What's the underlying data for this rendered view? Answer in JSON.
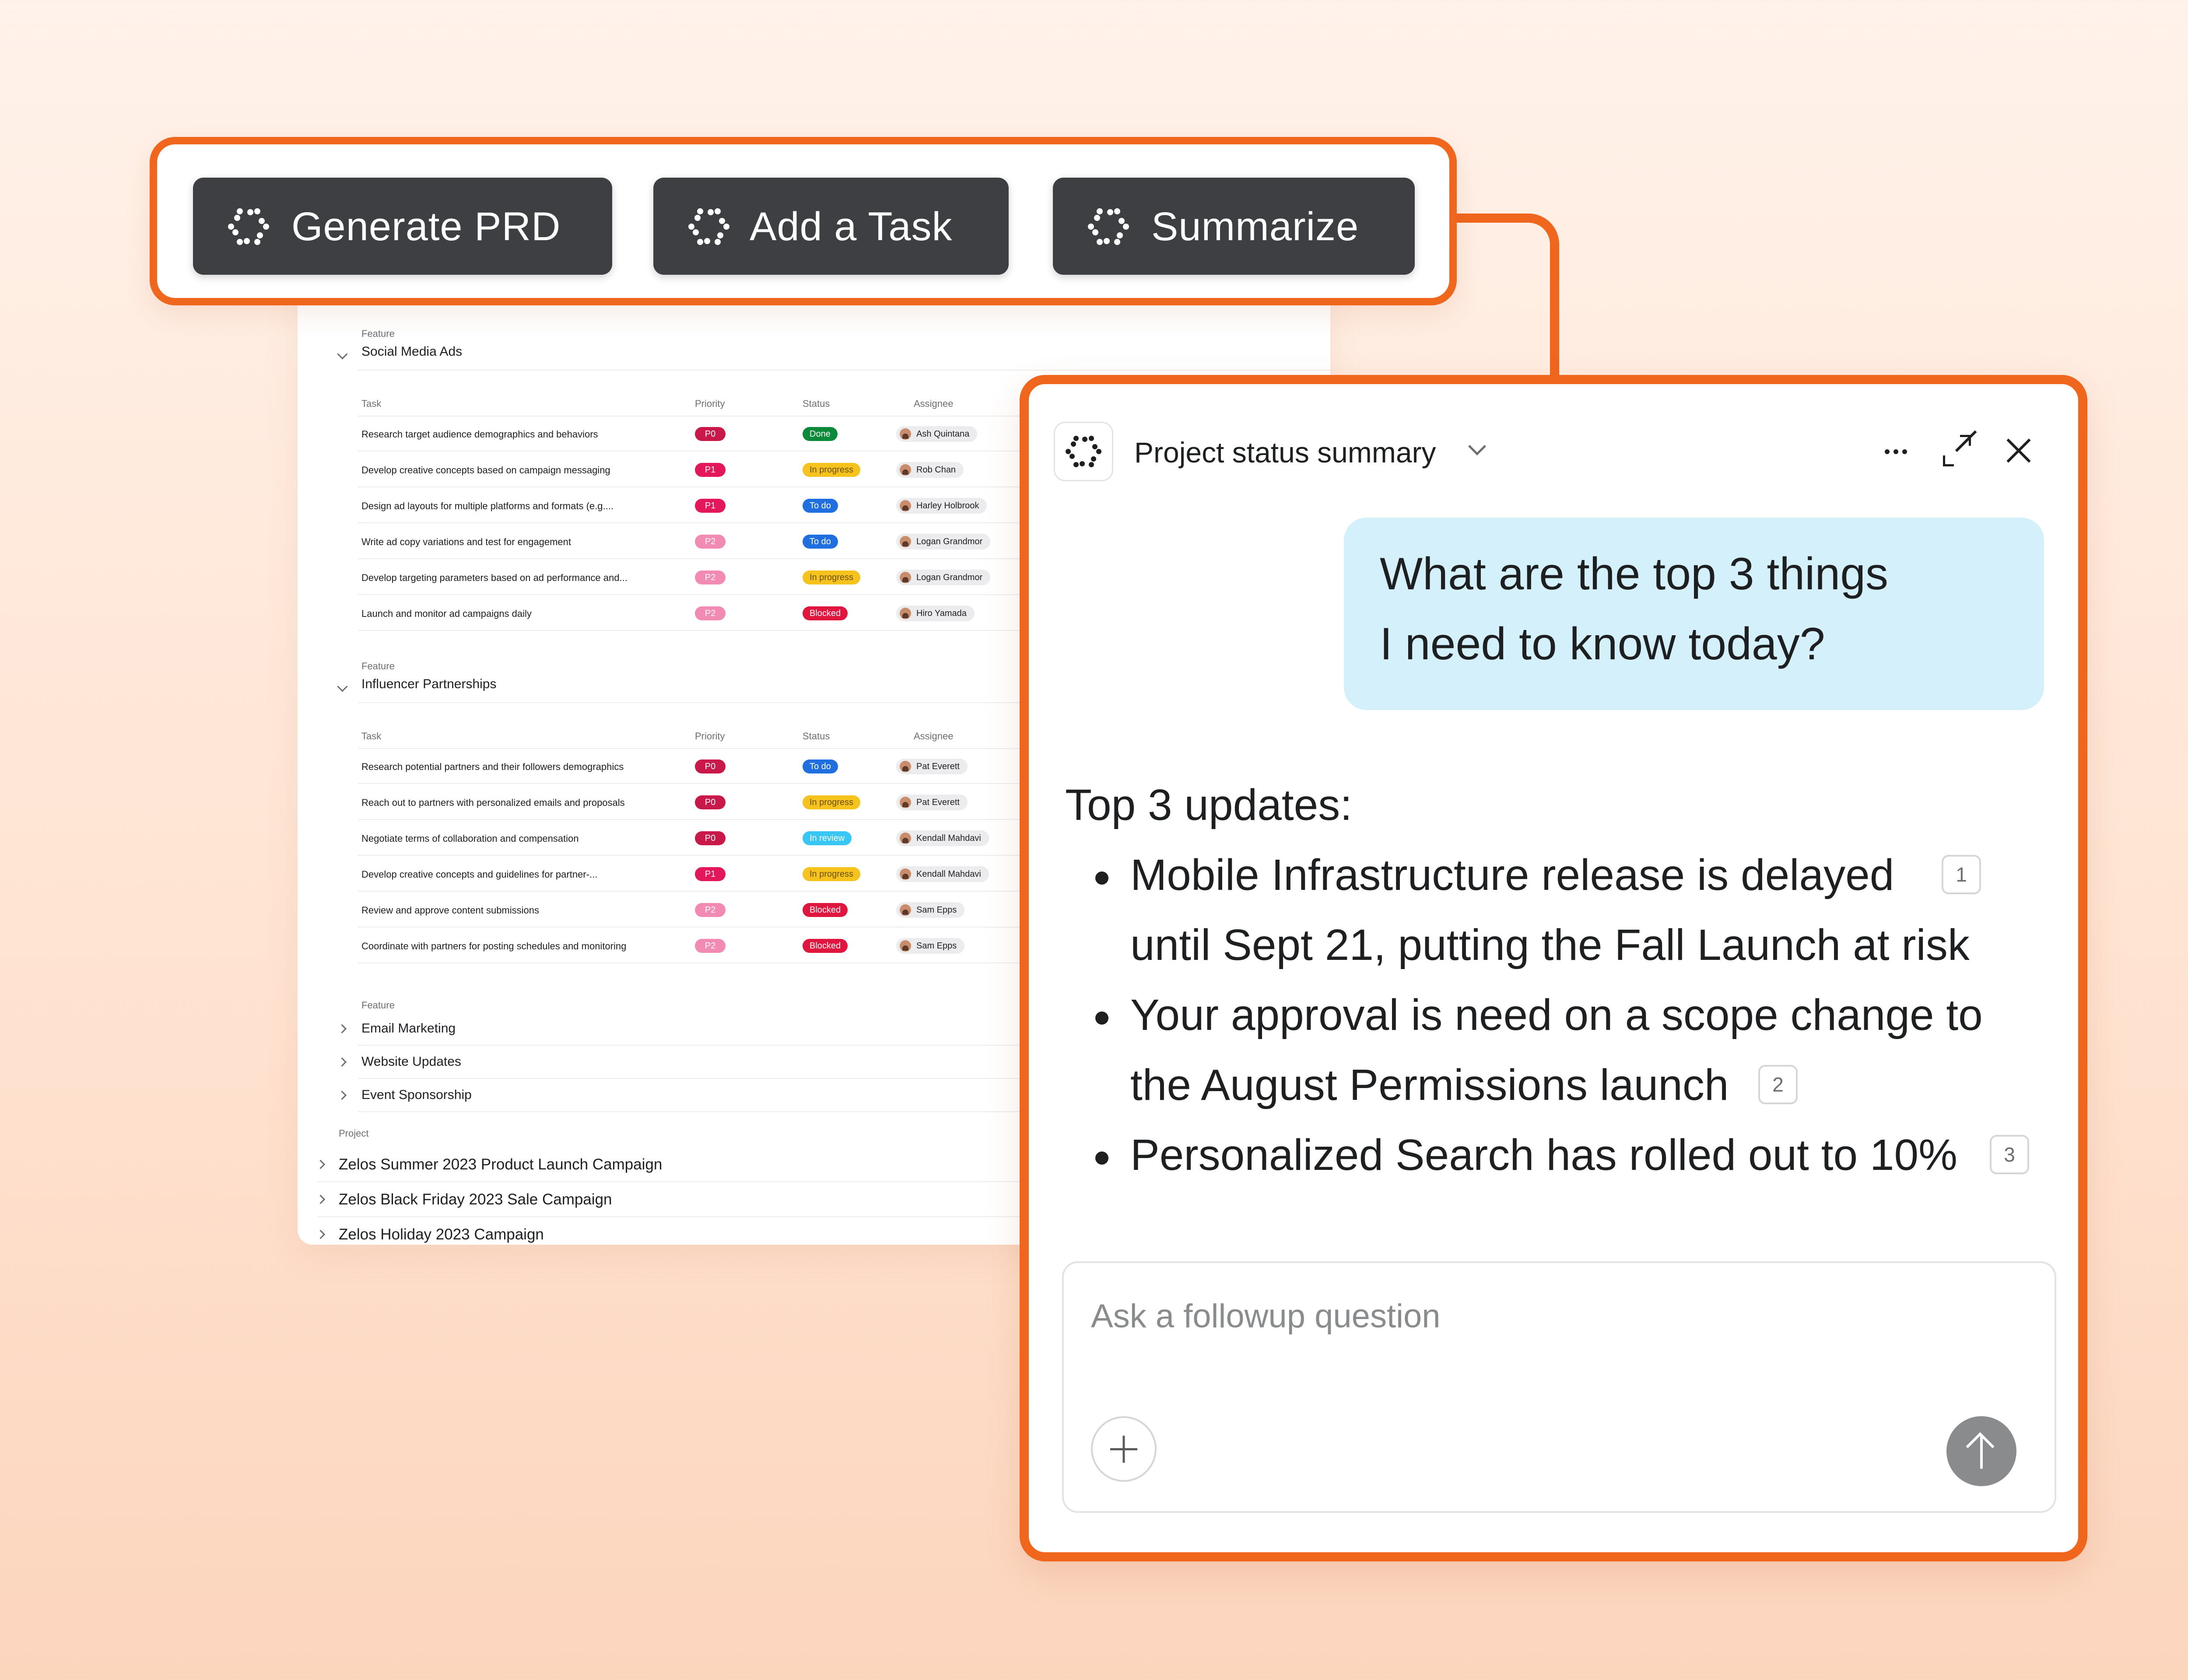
{
  "colors": {
    "accent": "#f0661c",
    "toolbar_button": "#3e3f42",
    "user_bubble": "#d3f0fb"
  },
  "toolbar": {
    "buttons": [
      {
        "label": "Generate PRD",
        "icon": "sparkle-icon"
      },
      {
        "label": "Add a Task",
        "icon": "sparkle-icon"
      },
      {
        "label": "Summarize",
        "icon": "sparkle-icon"
      }
    ]
  },
  "table": {
    "feature_kicker": "Feature",
    "columns": {
      "task": "Task",
      "priority": "Priority",
      "status": "Status",
      "assignee": "Assignee"
    },
    "features": [
      {
        "title": "Social Media Ads",
        "rows": [
          {
            "task": "Research target audience demographics and behaviors",
            "priority": "P0",
            "status": "Done",
            "assignee": "Ash Quintana"
          },
          {
            "task": "Develop creative concepts based on campaign messaging",
            "priority": "P1",
            "status": "In progress",
            "assignee": "Rob Chan"
          },
          {
            "task": "Design ad layouts for multiple platforms and formats (e.g....",
            "priority": "P1",
            "status": "To do",
            "assignee": "Harley Holbrook"
          },
          {
            "task": "Write ad copy variations and test for engagement",
            "priority": "P2",
            "status": "To do",
            "assignee": "Logan Grandmor"
          },
          {
            "task": "Develop targeting parameters based on ad performance and...",
            "priority": "P2",
            "status": "In progress",
            "assignee": "Logan Grandmor"
          },
          {
            "task": "Launch and monitor ad campaigns daily",
            "priority": "P2",
            "status": "Blocked",
            "assignee": "Hiro Yamada"
          }
        ]
      },
      {
        "title": "Influencer Partnerships",
        "rows": [
          {
            "task": "Research potential partners and their followers demographics",
            "priority": "P0",
            "status": "To do",
            "assignee": "Pat Everett"
          },
          {
            "task": "Reach out to partners with personalized emails and proposals",
            "priority": "P0",
            "status": "In progress",
            "assignee": "Pat Everett"
          },
          {
            "task": "Negotiate terms of collaboration and compensation",
            "priority": "P0",
            "status": "In review",
            "assignee": "Kendall Mahdavi"
          },
          {
            "task": "Develop creative concepts and guidelines for partner-...",
            "priority": "P1",
            "status": "In progress",
            "assignee": "Kendall Mahdavi"
          },
          {
            "task": "Review and approve content submissions",
            "priority": "P2",
            "status": "Blocked",
            "assignee": "Sam Epps"
          },
          {
            "task": "Coordinate with partners for posting schedules and monitoring",
            "priority": "P2",
            "status": "Blocked",
            "assignee": "Sam Epps"
          }
        ]
      }
    ],
    "collapsed_features": [
      "Email Marketing",
      "Website Updates",
      "Event Sponsorship"
    ],
    "project_kicker": "Project",
    "projects": [
      "Zelos Summer 2023 Product Launch Campaign",
      "Zelos Black Friday 2023 Sale Campaign",
      "Zelos Holiday 2023 Campaign"
    ]
  },
  "priority_colors": {
    "P0": "#c9184a",
    "P1": "#e3175a",
    "P2": "#f28bb4"
  },
  "status_colors": {
    "Done": "#0b8a3a",
    "In progress": "#f6c21c",
    "To do": "#1f6fe0",
    "Blocked": "#e0163f",
    "In review": "#38c6f4"
  },
  "chat": {
    "title": "Project status summary",
    "user_question_lines": [
      "What are the top 3 things",
      "I need to know today?"
    ],
    "answer_heading": "Top 3 updates:",
    "bullets": [
      {
        "lines": [
          "Mobile Infrastructure release is delayed",
          "until Sept 21, putting the Fall Launch at risk"
        ],
        "citation": "1"
      },
      {
        "lines": [
          "Your approval is need on a scope change to",
          "the August Permissions launch"
        ],
        "citation": "2"
      },
      {
        "lines": [
          "Personalized Search has rolled out to 10%"
        ],
        "citation": "3"
      }
    ],
    "composer_placeholder": "Ask a followup question"
  }
}
